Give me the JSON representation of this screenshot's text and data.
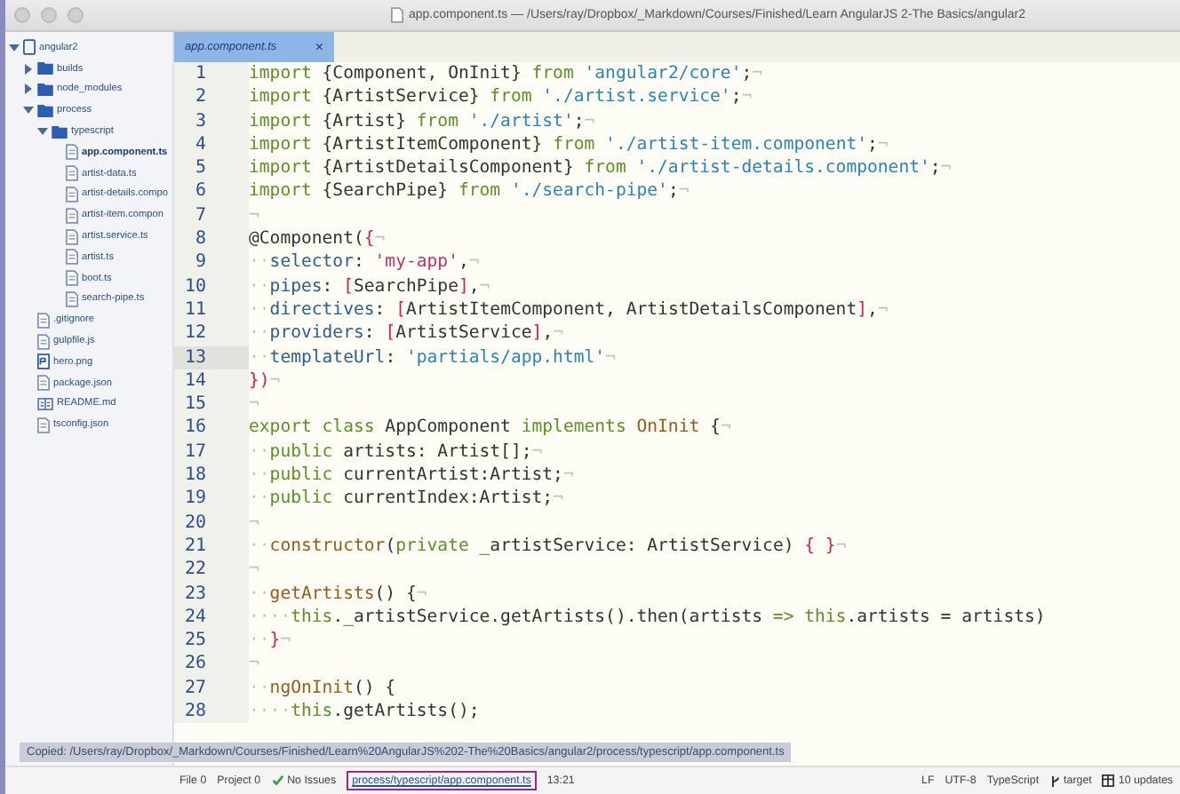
{
  "window": {
    "title": "app.component.ts — /Users/ray/Dropbox/_Markdown/Courses/Finished/Learn AngularJS 2-The Basics/angular2"
  },
  "sidebar": {
    "items": [
      {
        "label": "angular2",
        "kind": "project",
        "expanded": true,
        "selected": false,
        "children": [
          {
            "label": "builds",
            "kind": "folder",
            "expanded": false,
            "selected": false
          },
          {
            "label": "node_modules",
            "kind": "folder",
            "expanded": false,
            "selected": false
          },
          {
            "label": "process",
            "kind": "folder",
            "expanded": true,
            "selected": false,
            "children": [
              {
                "label": "typescript",
                "kind": "folder",
                "expanded": true,
                "selected": false,
                "children": [
                  {
                    "label": "app.component.ts",
                    "kind": "file",
                    "selected": true
                  },
                  {
                    "label": "artist-data.ts",
                    "kind": "file",
                    "selected": false
                  },
                  {
                    "label": "artist-details.compo",
                    "kind": "file",
                    "selected": false
                  },
                  {
                    "label": "artist-item.compon",
                    "kind": "file",
                    "selected": false
                  },
                  {
                    "label": "artist.service.ts",
                    "kind": "file",
                    "selected": false
                  },
                  {
                    "label": "artist.ts",
                    "kind": "file",
                    "selected": false
                  },
                  {
                    "label": "boot.ts",
                    "kind": "file",
                    "selected": false
                  },
                  {
                    "label": "search-pipe.ts",
                    "kind": "file",
                    "selected": false
                  }
                ]
              }
            ]
          },
          {
            "label": ".gitignore",
            "kind": "file",
            "selected": false
          },
          {
            "label": "gulpfile.js",
            "kind": "file",
            "selected": false
          },
          {
            "label": "hero.png",
            "kind": "image",
            "selected": false
          },
          {
            "label": "package.json",
            "kind": "file",
            "selected": false
          },
          {
            "label": "README.md",
            "kind": "markdown",
            "selected": false
          },
          {
            "label": "tsconfig.json",
            "kind": "file",
            "selected": false
          }
        ]
      }
    ]
  },
  "tabs": [
    {
      "label": "app.component.ts",
      "close": "×",
      "selected": true
    }
  ],
  "editor": {
    "lines": [
      {
        "n": "1",
        "current": false,
        "tokens": [
          {
            "kind": "kw",
            "text": "import"
          },
          {
            "kind": "pl",
            "text": " {Component, OnInit} "
          },
          {
            "kind": "kw",
            "text": "from"
          },
          {
            "kind": "str",
            "text": " 'angular2/core'"
          },
          {
            "kind": "pl",
            "text": ";"
          },
          {
            "kind": "inv",
            "text": "¬"
          }
        ]
      },
      {
        "n": "2",
        "current": false,
        "tokens": [
          {
            "kind": "kw",
            "text": "import"
          },
          {
            "kind": "pl",
            "text": " {ArtistService} "
          },
          {
            "kind": "kw",
            "text": "from"
          },
          {
            "kind": "str",
            "text": " './artist.service'"
          },
          {
            "kind": "pl",
            "text": ";"
          },
          {
            "kind": "inv",
            "text": "¬"
          }
        ]
      },
      {
        "n": "3",
        "current": false,
        "tokens": [
          {
            "kind": "kw",
            "text": "import"
          },
          {
            "kind": "pl",
            "text": " {Artist} "
          },
          {
            "kind": "kw",
            "text": "from"
          },
          {
            "kind": "str",
            "text": " './artist'"
          },
          {
            "kind": "pl",
            "text": ";"
          },
          {
            "kind": "inv",
            "text": "¬"
          }
        ]
      },
      {
        "n": "4",
        "current": false,
        "tokens": [
          {
            "kind": "kw",
            "text": "import"
          },
          {
            "kind": "pl",
            "text": " {ArtistItemComponent} "
          },
          {
            "kind": "kw",
            "text": "from"
          },
          {
            "kind": "str",
            "text": " './artist-item.component'"
          },
          {
            "kind": "pl",
            "text": ";"
          },
          {
            "kind": "inv",
            "text": "¬"
          }
        ]
      },
      {
        "n": "5",
        "current": false,
        "tokens": [
          {
            "kind": "kw",
            "text": "import"
          },
          {
            "kind": "pl",
            "text": " {ArtistDetailsComponent} "
          },
          {
            "kind": "kw",
            "text": "from"
          },
          {
            "kind": "str",
            "text": " './artist-details.component'"
          },
          {
            "kind": "pl",
            "text": ";"
          },
          {
            "kind": "inv",
            "text": "¬"
          }
        ]
      },
      {
        "n": "6",
        "current": false,
        "tokens": [
          {
            "kind": "kw",
            "text": "import"
          },
          {
            "kind": "pl",
            "text": " {SearchPipe} "
          },
          {
            "kind": "kw",
            "text": "from"
          },
          {
            "kind": "str",
            "text": " './search-pipe'"
          },
          {
            "kind": "pl",
            "text": ";"
          },
          {
            "kind": "inv",
            "text": "¬"
          }
        ]
      },
      {
        "n": "7",
        "current": false,
        "tokens": [
          {
            "kind": "inv",
            "text": "¬"
          }
        ]
      },
      {
        "n": "8",
        "current": false,
        "tokens": [
          {
            "kind": "pl",
            "text": "@Component("
          },
          {
            "kind": "br",
            "text": "{"
          },
          {
            "kind": "inv",
            "text": "¬"
          }
        ]
      },
      {
        "n": "9",
        "current": false,
        "tokens": [
          {
            "kind": "inv",
            "text": "··"
          },
          {
            "kind": "prop",
            "text": "selector"
          },
          {
            "kind": "pl",
            "text": ": "
          },
          {
            "kind": "str2",
            "text": "'my-app'"
          },
          {
            "kind": "pl",
            "text": ","
          },
          {
            "kind": "inv",
            "text": "¬"
          }
        ]
      },
      {
        "n": "10",
        "current": false,
        "tokens": [
          {
            "kind": "inv",
            "text": "··"
          },
          {
            "kind": "prop",
            "text": "pipes"
          },
          {
            "kind": "pl",
            "text": ": "
          },
          {
            "kind": "br",
            "text": "["
          },
          {
            "kind": "pl",
            "text": "SearchPipe"
          },
          {
            "kind": "br",
            "text": "]"
          },
          {
            "kind": "pl",
            "text": ","
          },
          {
            "kind": "inv",
            "text": "¬"
          }
        ]
      },
      {
        "n": "11",
        "current": false,
        "tokens": [
          {
            "kind": "inv",
            "text": "··"
          },
          {
            "kind": "prop",
            "text": "directives"
          },
          {
            "kind": "pl",
            "text": ": "
          },
          {
            "kind": "br",
            "text": "["
          },
          {
            "kind": "pl",
            "text": "ArtistItemComponent, ArtistDetailsComponent"
          },
          {
            "kind": "br",
            "text": "]"
          },
          {
            "kind": "pl",
            "text": ","
          },
          {
            "kind": "inv",
            "text": "¬"
          }
        ]
      },
      {
        "n": "12",
        "current": false,
        "tokens": [
          {
            "kind": "inv",
            "text": "··"
          },
          {
            "kind": "prop",
            "text": "providers"
          },
          {
            "kind": "pl",
            "text": ": "
          },
          {
            "kind": "br",
            "text": "["
          },
          {
            "kind": "pl",
            "text": "ArtistService"
          },
          {
            "kind": "br",
            "text": "]"
          },
          {
            "kind": "pl",
            "text": ","
          },
          {
            "kind": "inv",
            "text": "¬"
          }
        ]
      },
      {
        "n": "13",
        "current": true,
        "tokens": [
          {
            "kind": "inv",
            "text": "··"
          },
          {
            "kind": "prop",
            "text": "templateUrl"
          },
          {
            "kind": "pl",
            "text": ": "
          },
          {
            "kind": "str",
            "text": "'partials/app.html'"
          },
          {
            "kind": "inv",
            "text": "¬"
          }
        ]
      },
      {
        "n": "14",
        "current": false,
        "tokens": [
          {
            "kind": "br",
            "text": "})"
          },
          {
            "kind": "inv",
            "text": "¬"
          }
        ]
      },
      {
        "n": "15",
        "current": false,
        "tokens": [
          {
            "kind": "inv",
            "text": "¬"
          }
        ]
      },
      {
        "n": "16",
        "current": false,
        "tokens": [
          {
            "kind": "kw",
            "text": "export class"
          },
          {
            "kind": "pl",
            "text": " AppComponent "
          },
          {
            "kind": "kw",
            "text": "implements"
          },
          {
            "kind": "fn",
            "text": " OnInit"
          },
          {
            "kind": "pl",
            "text": " {"
          },
          {
            "kind": "inv",
            "text": "¬"
          }
        ]
      },
      {
        "n": "17",
        "current": false,
        "tokens": [
          {
            "kind": "inv",
            "text": "··"
          },
          {
            "kind": "kw",
            "text": "public"
          },
          {
            "kind": "pl",
            "text": " artists: Artist[];"
          },
          {
            "kind": "inv",
            "text": "¬"
          }
        ]
      },
      {
        "n": "18",
        "current": false,
        "tokens": [
          {
            "kind": "inv",
            "text": "··"
          },
          {
            "kind": "kw",
            "text": "public"
          },
          {
            "kind": "pl",
            "text": " currentArtist:Artist;"
          },
          {
            "kind": "inv",
            "text": "¬"
          }
        ]
      },
      {
        "n": "19",
        "current": false,
        "tokens": [
          {
            "kind": "inv",
            "text": "··"
          },
          {
            "kind": "kw",
            "text": "public"
          },
          {
            "kind": "pl",
            "text": " currentIndex:Artist;"
          },
          {
            "kind": "inv",
            "text": "¬"
          }
        ]
      },
      {
        "n": "20",
        "current": false,
        "tokens": [
          {
            "kind": "inv",
            "text": "¬"
          }
        ]
      },
      {
        "n": "21",
        "current": false,
        "tokens": [
          {
            "kind": "inv",
            "text": "··"
          },
          {
            "kind": "fn",
            "text": "constructor"
          },
          {
            "kind": "pl",
            "text": "("
          },
          {
            "kind": "kw",
            "text": "private"
          },
          {
            "kind": "pl",
            "text": " _artistService: ArtistService) "
          },
          {
            "kind": "br",
            "text": "{ }"
          },
          {
            "kind": "inv",
            "text": "¬"
          }
        ]
      },
      {
        "n": "22",
        "current": false,
        "tokens": [
          {
            "kind": "inv",
            "text": "¬"
          }
        ]
      },
      {
        "n": "23",
        "current": false,
        "tokens": [
          {
            "kind": "inv",
            "text": "··"
          },
          {
            "kind": "fn",
            "text": "getArtists"
          },
          {
            "kind": "pl",
            "text": "() {"
          },
          {
            "kind": "inv",
            "text": "¬"
          }
        ]
      },
      {
        "n": "24",
        "current": false,
        "tokens": [
          {
            "kind": "inv",
            "text": "····"
          },
          {
            "kind": "kw",
            "text": "this"
          },
          {
            "kind": "pl",
            "text": "._artistService.getArtists().then(artists "
          },
          {
            "kind": "kw",
            "text": "=> this"
          },
          {
            "kind": "pl",
            "text": ".artists = artists)"
          }
        ]
      },
      {
        "n": "25",
        "current": false,
        "tokens": [
          {
            "kind": "inv",
            "text": "··"
          },
          {
            "kind": "br",
            "text": "}"
          },
          {
            "kind": "inv",
            "text": "¬"
          }
        ]
      },
      {
        "n": "26",
        "current": false,
        "tokens": [
          {
            "kind": "inv",
            "text": "¬"
          }
        ]
      },
      {
        "n": "27",
        "current": false,
        "tokens": [
          {
            "kind": "inv",
            "text": "··"
          },
          {
            "kind": "fn",
            "text": "ngOnInit"
          },
          {
            "kind": "pl",
            "text": "() {"
          }
        ]
      },
      {
        "n": "28",
        "current": false,
        "tokens": [
          {
            "kind": "inv",
            "text": "····"
          },
          {
            "kind": "kw",
            "text": "this"
          },
          {
            "kind": "pl",
            "text": ".getArtists();"
          }
        ]
      }
    ]
  },
  "tooltip": "Copied: /Users/ray/Dropbox/_Markdown/Courses/Finished/Learn%20AngularJS%202-The%20Basics/angular2/process/typescript/app.component.ts",
  "status_bar": {
    "file": "File 0",
    "project": "Project 0",
    "issues": "No Issues",
    "path": "process/typescript/app.component.ts",
    "position": "13:21",
    "line_ending": "LF",
    "encoding": "UTF-8",
    "grammar": "TypeScript",
    "branch": "target",
    "updates": "10 updates"
  }
}
